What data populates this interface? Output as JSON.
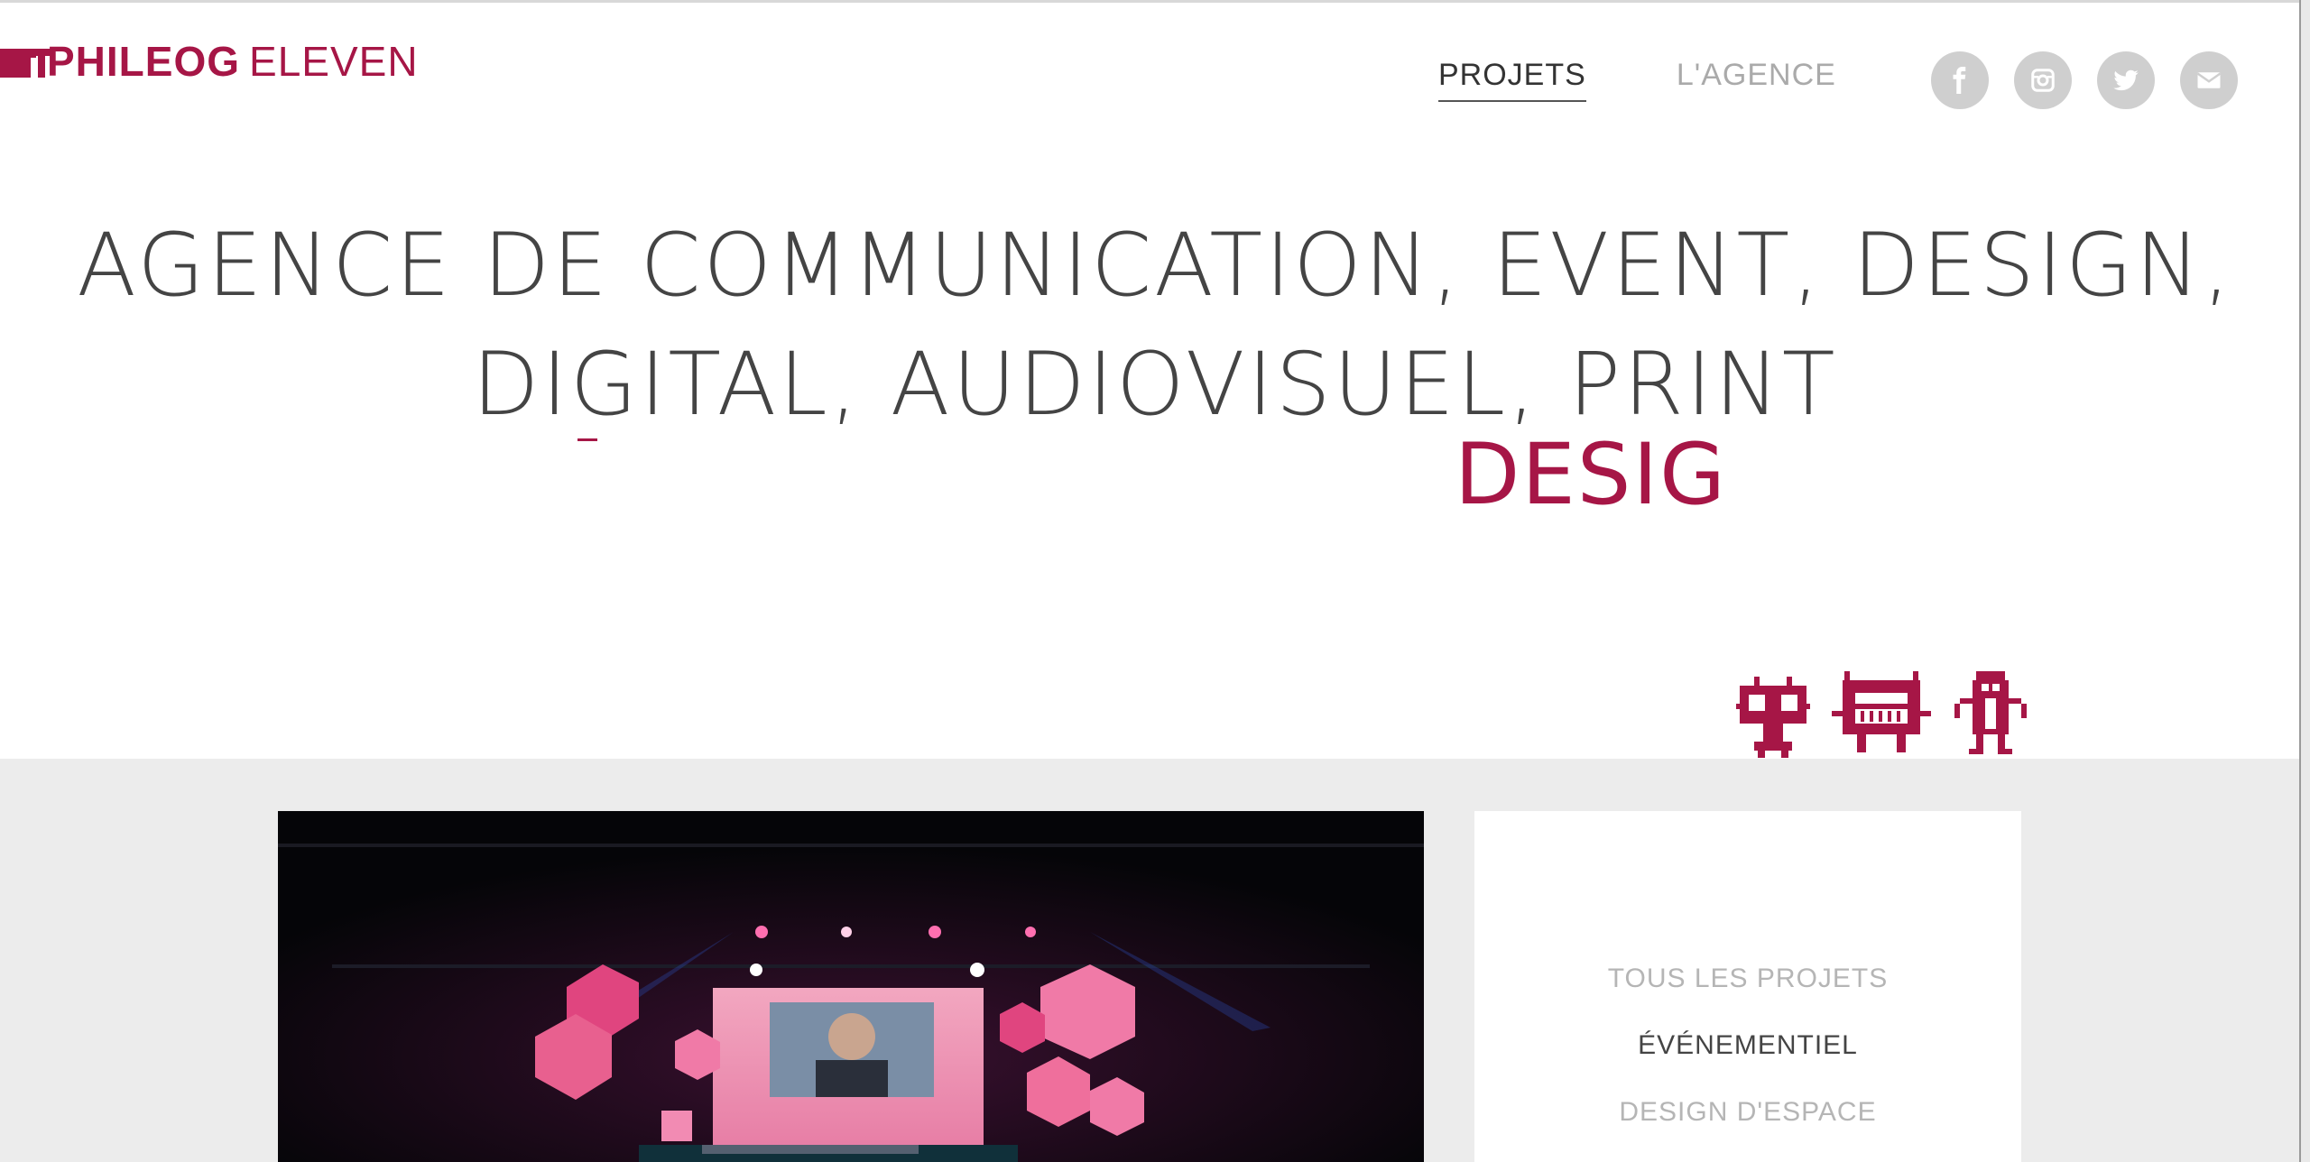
{
  "brand": {
    "name_bold": "PHILEOG",
    "name_light": "ELEVEN",
    "color": "#a61646"
  },
  "nav": {
    "items": [
      {
        "label": "PROJETS",
        "active": true
      },
      {
        "label": "L'AGENCE",
        "active": false
      }
    ]
  },
  "socials": [
    {
      "name": "facebook-icon",
      "glyph": "f"
    },
    {
      "name": "instagram-icon",
      "glyph": ""
    },
    {
      "name": "twitter-icon",
      "glyph": ""
    },
    {
      "name": "mail-icon",
      "glyph": ""
    }
  ],
  "hero": {
    "line1": "AGENCE DE COMMUNICATION, EVENT, DESIGN,",
    "line2": "DIGITAL, AUDIOVISUEL, PRINT",
    "rotating_word": "DESIGN"
  },
  "filters": {
    "items": [
      {
        "label": "TOUS LES PROJETS",
        "active": false
      },
      {
        "label": "ÉVÉNEMENTIEL",
        "active": true
      },
      {
        "label": "DESIGN D'ESPACE",
        "active": false
      }
    ]
  },
  "colors": {
    "accent": "#a61646",
    "band": "#ececec",
    "social_bg": "#cfcfcf"
  }
}
